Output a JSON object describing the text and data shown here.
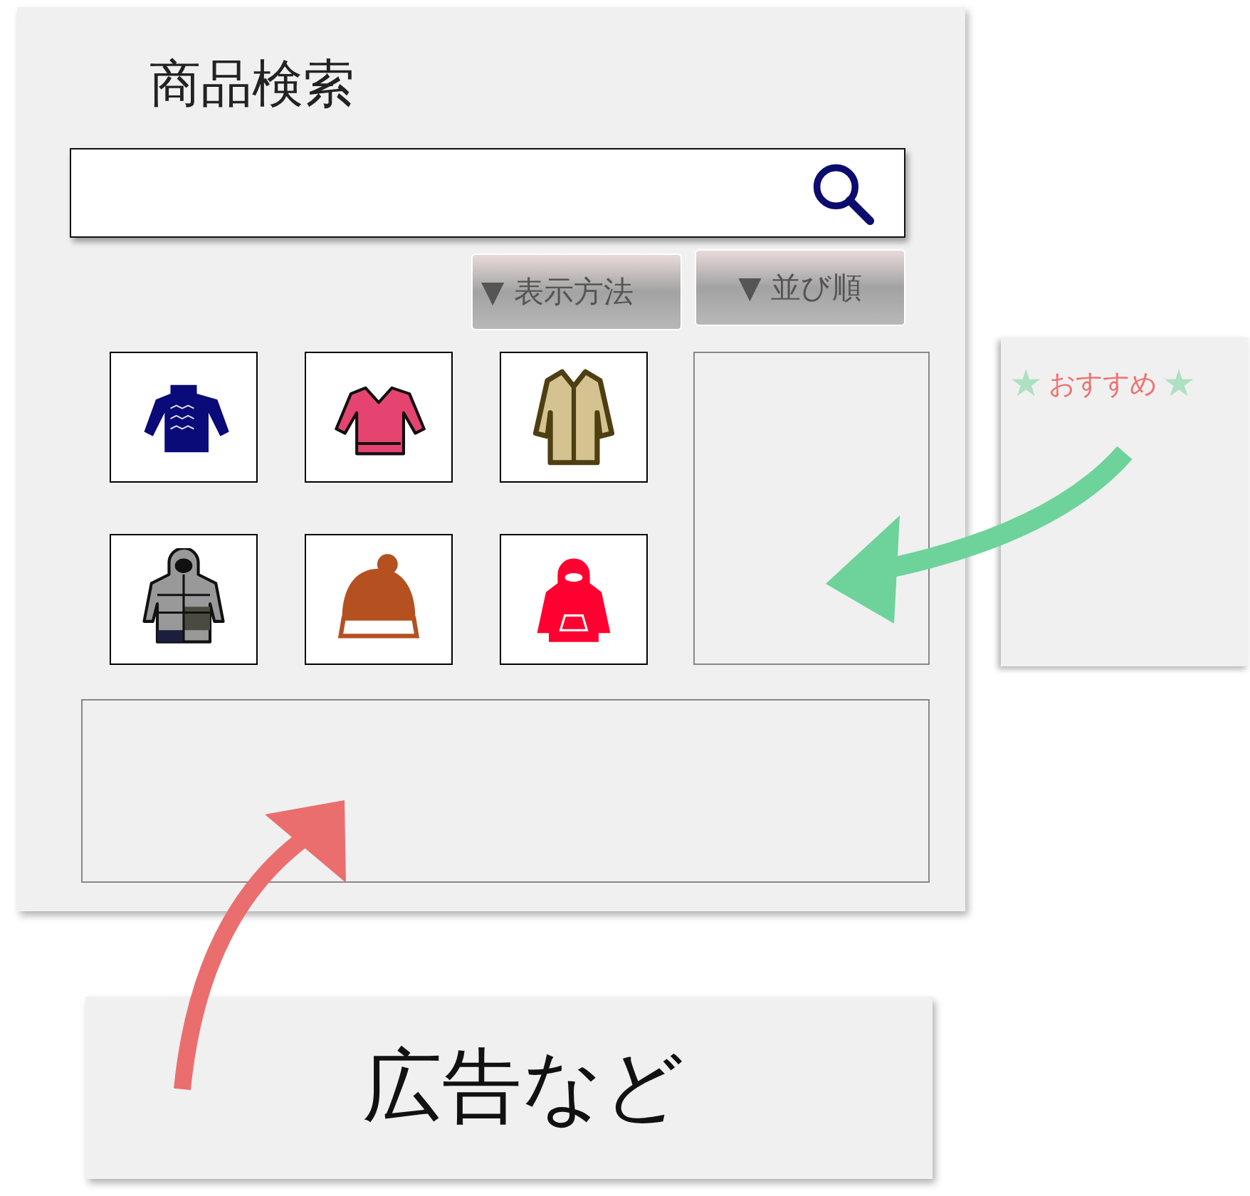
{
  "page_title": "商品検索",
  "buttons": [
    {
      "label": "▼ 表示方法"
    },
    {
      "label": "▼ 並び順"
    }
  ],
  "products": [
    {
      "kind": "sweater"
    },
    {
      "kind": "shirt"
    },
    {
      "kind": "coat"
    },
    {
      "kind": "down-jacket"
    },
    {
      "kind": "beanie"
    },
    {
      "kind": "hoodie"
    }
  ],
  "recommend_note": {
    "mark_before": "★",
    "label": "おすすめ",
    "mark_after": "★"
  },
  "ad_note": {
    "label": "広告など"
  }
}
